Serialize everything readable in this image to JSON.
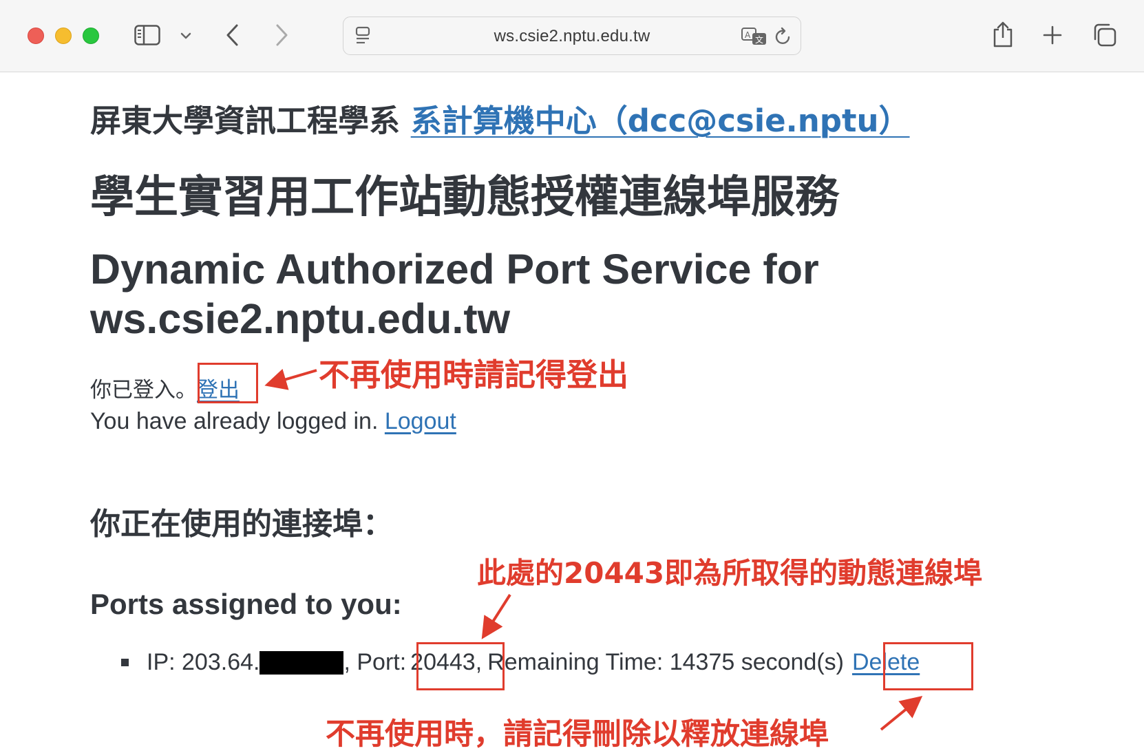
{
  "browser": {
    "url": "ws.csie2.nptu.edu.tw"
  },
  "page": {
    "org_prefix": "屏東大學資訊工程學系",
    "org_link": "系計算機中心（dcc@csie.nptu）",
    "title_zh": "學生實習用工作站動態授權連線埠服務",
    "title_en": "Dynamic Authorized Port Service for ws.csie2.nptu.edu.tw",
    "login_zh_text": "你已登入。",
    "logout_zh": "登出",
    "login_en_text": "You have already logged in. ",
    "logout_en": "Logout",
    "ports_heading_zh": "你正在使用的連接埠：",
    "ports_heading_en": "Ports assigned to you:",
    "port_entry": {
      "ip_label": "IP: 203.64.",
      "port_label": ", Port: ",
      "port_value": "20443,",
      "remaining": "Remaining Time: 14375 second(s)",
      "delete": "Delete"
    }
  },
  "annotations": {
    "logout_note": "不再使用時請記得登出",
    "port_note": "此處的20443即為所取得的動態連線埠",
    "delete_note": "不再使用時，請記得刪除以釋放連線埠"
  },
  "colors": {
    "annotation": "#e03c2d",
    "link": "#2f73b5",
    "text": "#33373d"
  }
}
